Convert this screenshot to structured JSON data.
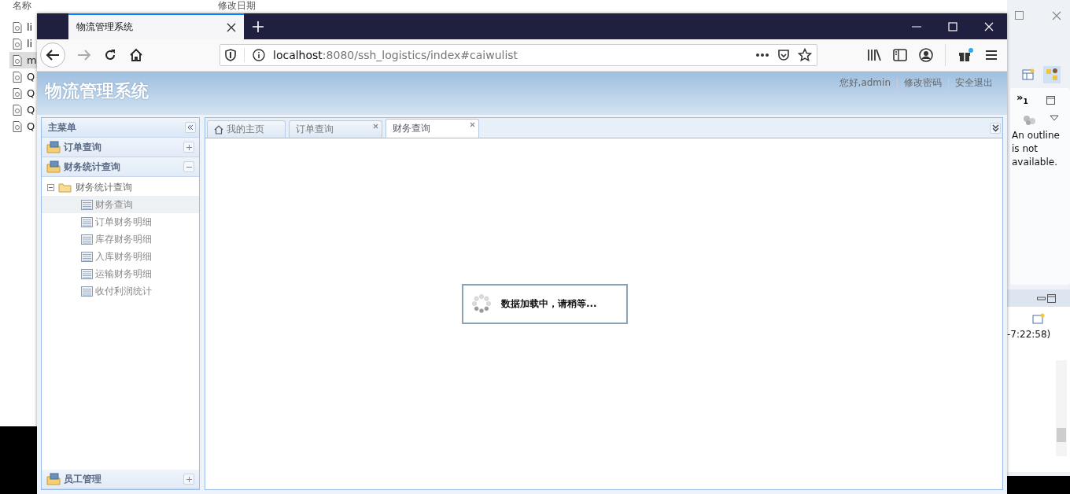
{
  "desktop": {
    "explorer": {
      "columns": [
        "名称",
        "修改日期"
      ],
      "files": [
        {
          "name": "li",
          "selected": false
        },
        {
          "name": "li",
          "selected": false
        },
        {
          "name": "m",
          "selected": true
        },
        {
          "name": "Q",
          "selected": false
        },
        {
          "name": "Q",
          "selected": false
        },
        {
          "name": "Q",
          "selected": false
        },
        {
          "name": "Q",
          "selected": false
        }
      ]
    },
    "eclipse": {
      "view_badge": "»",
      "view_badge_count": "1",
      "outline_message": "An outline is not available.",
      "console_text": "-7:22:58)"
    }
  },
  "browser": {
    "tab_title": "物流管理系统",
    "url_host": "localhost",
    "url_rest": ":8080/ssh_logistics/index#caiwulist"
  },
  "app": {
    "title": "物流管理系统",
    "header_links": [
      "您好,admin",
      "修改密码",
      "安全退出"
    ],
    "menu_title": "主菜单",
    "accordion": [
      {
        "label": "订单查询",
        "expanded": false
      },
      {
        "label": "财务统计查询",
        "expanded": true,
        "tree": {
          "label": "财务统计查询",
          "expanded": true,
          "children": [
            {
              "label": "财务查询",
              "selected": true
            },
            {
              "label": "订单财务明细",
              "selected": false
            },
            {
              "label": "库存财务明细",
              "selected": false
            },
            {
              "label": "入库财务明细",
              "selected": false
            },
            {
              "label": "运输财务明细",
              "selected": false
            },
            {
              "label": "收付利润统计",
              "selected": false
            }
          ]
        }
      },
      {
        "label": "员工管理",
        "expanded": false
      }
    ],
    "tabs": [
      {
        "label": "我的主页",
        "kind": "home",
        "selected": false
      },
      {
        "label": "订单查询",
        "kind": "closable",
        "selected": false
      },
      {
        "label": "财务查询",
        "kind": "closable",
        "selected": true
      }
    ],
    "loading": "数据加载中，请稍等..."
  }
}
